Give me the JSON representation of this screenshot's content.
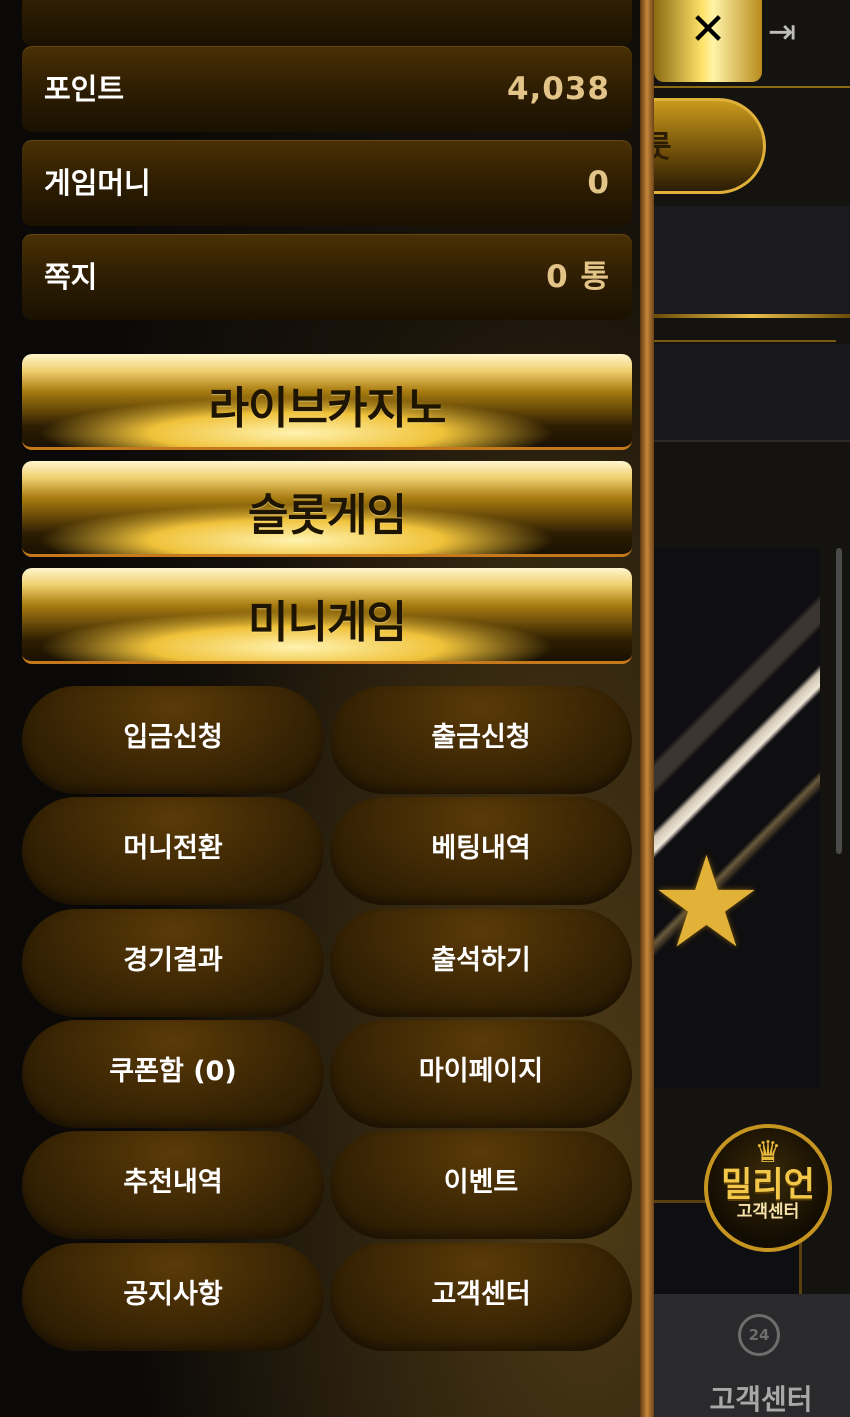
{
  "info_rows": [
    {
      "label": "포인트",
      "value": "4,038"
    },
    {
      "label": "게임머니",
      "value": "0"
    },
    {
      "label": "쪽지",
      "value": "0 통"
    }
  ],
  "game_buttons": [
    {
      "label": "라이브카지노"
    },
    {
      "label": "슬롯게임"
    },
    {
      "label": "미니게임"
    }
  ],
  "menu": [
    {
      "label": "입금신청"
    },
    {
      "label": "출금신청"
    },
    {
      "label": "머니전환"
    },
    {
      "label": "베팅내역"
    },
    {
      "label": "경기결과"
    },
    {
      "label": "출석하기"
    },
    {
      "label": "쿠폰함 (0)"
    },
    {
      "label": "마이페이지"
    },
    {
      "label": "추천내역"
    },
    {
      "label": "이벤트"
    },
    {
      "label": "공지사항"
    },
    {
      "label": "고객센터"
    }
  ],
  "background": {
    "pill_text": "룻",
    "badge": {
      "title": "밀리언",
      "subtitle": "고객센터"
    },
    "footer_label": "고객센터",
    "clock_text": "24"
  },
  "icons": {
    "close": "close-icon",
    "exit": "exit-icon",
    "crown": "crown-icon",
    "star": "star-icon",
    "clock": "clock-24-icon"
  },
  "colors": {
    "gold": "#f0c23a",
    "value_text": "#e3c488",
    "row_bg": "#2c1c02"
  }
}
